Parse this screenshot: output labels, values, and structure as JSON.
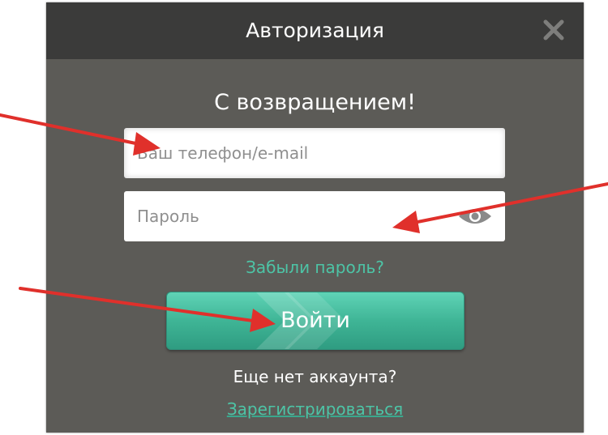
{
  "dialog": {
    "title": "Авторизация",
    "close_icon": "close-icon",
    "heading": "С возвращением!"
  },
  "form": {
    "login_placeholder": "Ваш телефон/e-mail",
    "login_value": "",
    "password_placeholder": "Пароль",
    "password_value": "",
    "eye_icon": "eye-icon",
    "forgot_link": "Забыли пароль?",
    "submit_label": "Войти",
    "no_account_text": "Еще нет аккаунта?",
    "register_link": "Зарегистрироваться"
  },
  "colors": {
    "dialog_background": "#5c5b57",
    "titlebar_background": "#3b3b3a",
    "accent": "#45b99b",
    "link": "#4dc4a6",
    "arrow": "#e0302b"
  }
}
